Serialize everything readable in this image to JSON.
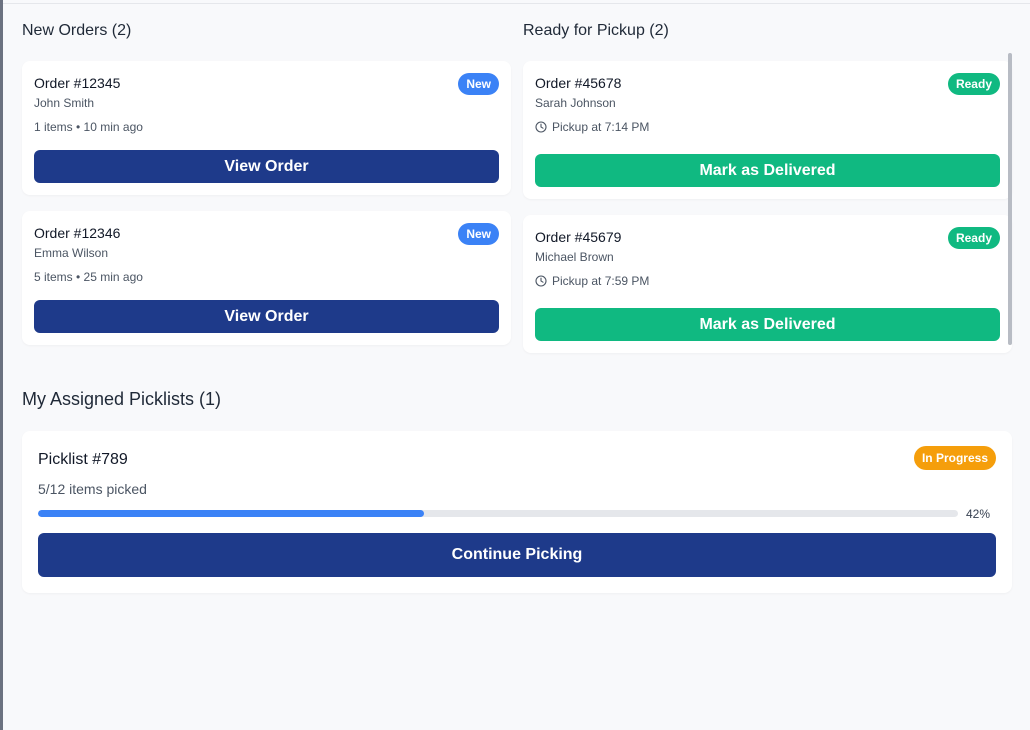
{
  "new_orders": {
    "title": "New Orders (2)",
    "orders": [
      {
        "id": "Order #12345",
        "customer": "John Smith",
        "meta": "1 items • 10 min ago",
        "badge": "New",
        "button": "View Order"
      },
      {
        "id": "Order #12346",
        "customer": "Emma Wilson",
        "meta": "5 items • 25 min ago",
        "badge": "New",
        "button": "View Order"
      }
    ]
  },
  "ready_for_pickup": {
    "title": "Ready for Pickup (2)",
    "orders": [
      {
        "id": "Order #45678",
        "customer": "Sarah Johnson",
        "pickup": "Pickup at 7:14 PM",
        "badge": "Ready",
        "button": "Mark as Delivered"
      },
      {
        "id": "Order #45679",
        "customer": "Michael Brown",
        "pickup": "Pickup at 7:59 PM",
        "badge": "Ready",
        "button": "Mark as Delivered"
      }
    ]
  },
  "picklists": {
    "title": "My Assigned Picklists (1)",
    "items": [
      {
        "id": "Picklist #789",
        "status": "In Progress",
        "progress_text": "5/12 items picked",
        "progress_percent": 42,
        "progress_label": "42%",
        "button": "Continue Picking"
      }
    ]
  },
  "colors": {
    "navy": "#1e3a8a",
    "green": "#10b981",
    "blue": "#3b82f6",
    "orange": "#f59e0b",
    "background": "#f8f9fb"
  },
  "icons": {
    "pickup": "clock-icon"
  }
}
